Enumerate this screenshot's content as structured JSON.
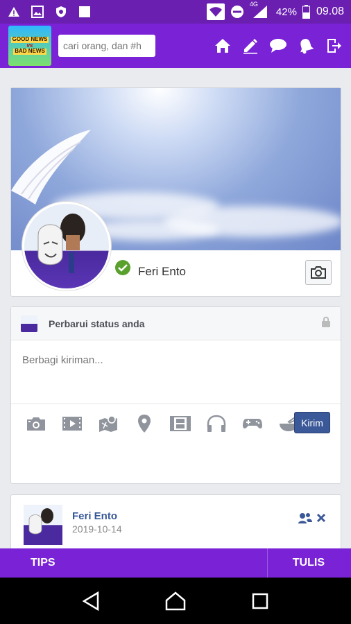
{
  "status_bar": {
    "network": "4G",
    "battery": "42%",
    "time": "09.08",
    "icons_left": [
      "warning-icon",
      "image-icon",
      "shield-icon",
      "square-icon"
    ],
    "icons_right": [
      "wifi-icon",
      "do-not-disturb-icon",
      "signal-icon",
      "battery-icon"
    ]
  },
  "app_bar": {
    "logo_text": [
      "GOOD NEWS",
      "vs",
      "BAD NEWS"
    ],
    "search_placeholder": "cari orang, dan #h",
    "icons": [
      "home-icon",
      "edit-icon",
      "chat-icon",
      "notification-bell-icon",
      "logout-icon"
    ]
  },
  "profile": {
    "name": "Feri Ento",
    "verified": true
  },
  "composer": {
    "title": "Perbarui status anda",
    "placeholder": "Berbagi kiriman...",
    "submit_label": "Kirim",
    "tools": [
      "camera-icon",
      "video-icon",
      "map-icon",
      "location-pin-icon",
      "film-icon",
      "headphones-icon",
      "gamepad-icon",
      "food-bowl-icon"
    ]
  },
  "post": {
    "author": "Feri Ento",
    "date": "2019-10-14"
  },
  "bottom_tabs": {
    "left": "TIPS",
    "right": "TULIS"
  },
  "colors": {
    "primary": "#7a22d6",
    "status_bar": "#6a1fb0",
    "button_blue": "#3b5998",
    "verified_green": "#5aa02c",
    "link_blue": "#365899"
  }
}
